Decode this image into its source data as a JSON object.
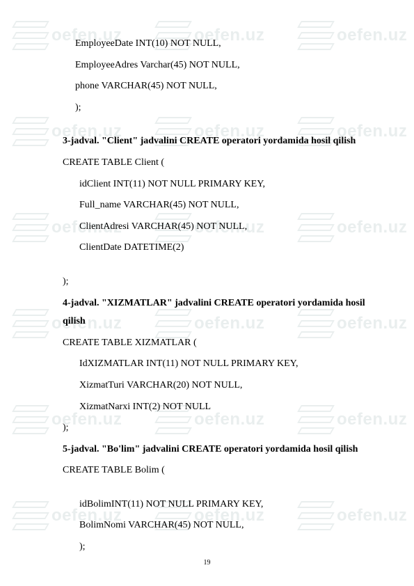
{
  "watermark": "oefen.uz",
  "section1": {
    "lines": [
      "EmployeeDate INT(10) NOT NULL,",
      "EmployeeAdres Varchar(45) NOT NULL,",
      "phone VARCHAR(45) NOT NULL,",
      ");"
    ]
  },
  "heading3": "3-jadval. \"Client\" jadvalini CREATE operatori yordamida hosil qilish",
  "section2": {
    "open": "CREATE TABLE Client (",
    "lines": [
      "idClient INT(11) NOT NULL PRIMARY KEY,",
      "Full_name VARCHAR(45)  NOT NULL,",
      "ClientAdresi VARCHAR(45) NOT NULL,",
      "ClientDate DATETIME(2)"
    ],
    "close": ");"
  },
  "heading4": "4-jadval. \"XIZMATLAR\" jadvalini CREATE operatori yordamida hosil qilish",
  "section3": {
    "open": "CREATE TABLE XIZMATLAR (",
    "lines": [
      "IdXIZMATLAR INT(11) NOT NULL PRIMARY KEY,",
      "XizmatTuri VARCHAR(20) NOT NULL,",
      "XizmatNarxi INT(2) NOT NULL"
    ],
    "close": ");"
  },
  "heading5": "5-jadval. \"Bo'lim\" jadvalini CREATE operatori yordamida hosil qilish",
  "section4": {
    "open": "CREATE TABLE Bolim (",
    "lines": [
      "idBolimINT(11) NOT NULL PRIMARY KEY,",
      "BolimNomi VARCHAR(45)  NOT NULL,",
      ");"
    ]
  },
  "pageNumber": "19"
}
